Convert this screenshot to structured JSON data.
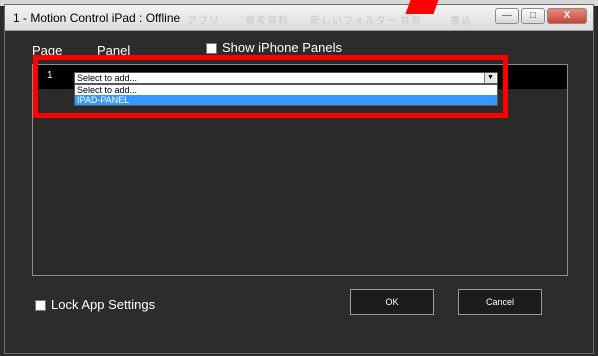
{
  "window": {
    "title": "1 - Motion Control iPad : Offline",
    "faded_title_fragments": [
      "アプリ",
      "参考資料",
      "新しいフォルダー",
      "共有",
      "書込"
    ],
    "buttons": {
      "minimize": "—",
      "maximize": "□",
      "close": "X"
    }
  },
  "headers": {
    "page": "Page",
    "panel": "Panel",
    "show_iphone_panels": "Show iPhone Panels",
    "show_iphone_panels_checked": false
  },
  "panel_list": {
    "row_number": "1",
    "select_value": "Select to add...",
    "dropdown_options": [
      "Select to add...",
      "IPAD-PANEL"
    ],
    "highlighted_option_index": 1
  },
  "footer": {
    "lock_app_settings": "Lock App Settings",
    "lock_app_settings_checked": false,
    "ok": "OK",
    "cancel": "Cancel"
  },
  "colors": {
    "annotation": "#ff0000",
    "selection": "#3399ff",
    "dialog_bg": "#2c2c2c"
  }
}
